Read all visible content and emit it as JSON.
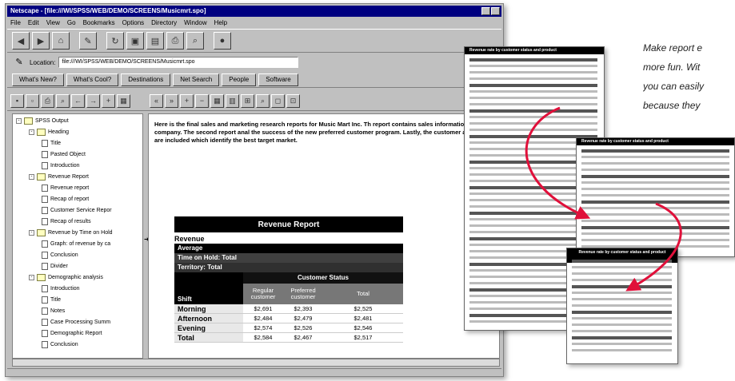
{
  "window": {
    "title": "Netscape - [file:///WI/SPSS/WEB/DEMO/SCREENS/Musicmrt.spo]",
    "menu": [
      "File",
      "Edit",
      "View",
      "Go",
      "Bookmarks",
      "Options",
      "Directory",
      "Window",
      "Help"
    ],
    "location_label": "Location:",
    "location_value": "file:///WI/SPSS/WEB/DEMO/SCREENS/Musicmrt.spo",
    "directory_buttons": [
      "What's New?",
      "What's Cool?",
      "Destinations",
      "Net Search",
      "People",
      "Software"
    ]
  },
  "outline": {
    "items": [
      {
        "label": "SPSS Output",
        "level": 0,
        "type": "book",
        "toggle": "-"
      },
      {
        "label": "Heading",
        "level": 1,
        "type": "book",
        "toggle": "-"
      },
      {
        "label": "Title",
        "level": 2,
        "type": "doc"
      },
      {
        "label": "Pasted Object",
        "level": 2,
        "type": "doc"
      },
      {
        "label": "Introduction",
        "level": 2,
        "type": "doc"
      },
      {
        "label": "Revenue Report",
        "level": 1,
        "type": "book",
        "toggle": "-"
      },
      {
        "label": "Revenue report",
        "level": 2,
        "type": "doc"
      },
      {
        "label": "Recap of report",
        "level": 2,
        "type": "doc"
      },
      {
        "label": "Customer Service Repor",
        "level": 2,
        "type": "doc"
      },
      {
        "label": "Recap of results",
        "level": 2,
        "type": "doc"
      },
      {
        "label": "Revenue by Time on Hold",
        "level": 1,
        "type": "book",
        "toggle": "-"
      },
      {
        "label": "Graph: of revenue by ca",
        "level": 2,
        "type": "doc"
      },
      {
        "label": "Conclusion",
        "level": 2,
        "type": "doc"
      },
      {
        "label": "Divider",
        "level": 2,
        "type": "doc"
      },
      {
        "label": "Demographic analysis",
        "level": 1,
        "type": "book",
        "toggle": "-"
      },
      {
        "label": "Introduction",
        "level": 2,
        "type": "doc"
      },
      {
        "label": "Title",
        "level": 2,
        "type": "doc"
      },
      {
        "label": "Notes",
        "level": 2,
        "type": "doc"
      },
      {
        "label": "Case Processing Summ",
        "level": 2,
        "type": "doc"
      },
      {
        "label": "Demographic Report",
        "level": 2,
        "type": "doc"
      },
      {
        "label": "Conclusion",
        "level": 2,
        "type": "doc"
      }
    ]
  },
  "content": {
    "intro": "Here is the final sales and marketing research reports for Music Mart Inc. Th report contains sales information for the company. The second report anal the success of the new preferred customer program. Lastly, the customer a results are included which identify the best target market.",
    "report": {
      "title": "Revenue Report",
      "subtitle": "Revenue",
      "band1": "Average",
      "band2": "Time on Hold: Total",
      "band3": "Territory: Total",
      "customer_status": "Customer Status",
      "col_shift": "Shift",
      "columns": [
        "Regular customer",
        "Preferred customer",
        "Total"
      ],
      "rows": [
        {
          "shift": "Morning",
          "values": [
            "$2,691",
            "$2,393",
            "$2,525"
          ]
        },
        {
          "shift": "Afternoon",
          "values": [
            "$2,484",
            "$2,479",
            "$2,481"
          ]
        },
        {
          "shift": "Evening",
          "values": [
            "$2,574",
            "$2,526",
            "$2,546"
          ]
        },
        {
          "shift": "Total",
          "values": [
            "$2,584",
            "$2,467",
            "$2,517"
          ]
        }
      ]
    }
  },
  "collage": {
    "lines": [
      "Make report e",
      "more fun. Wit",
      "you can easily",
      "because they"
    ],
    "page1_title": "Revenue rate by customer status and product",
    "page2_title": "Revenue rate by customer status and product",
    "page3_title": "Revenue rate by customer status and product"
  }
}
